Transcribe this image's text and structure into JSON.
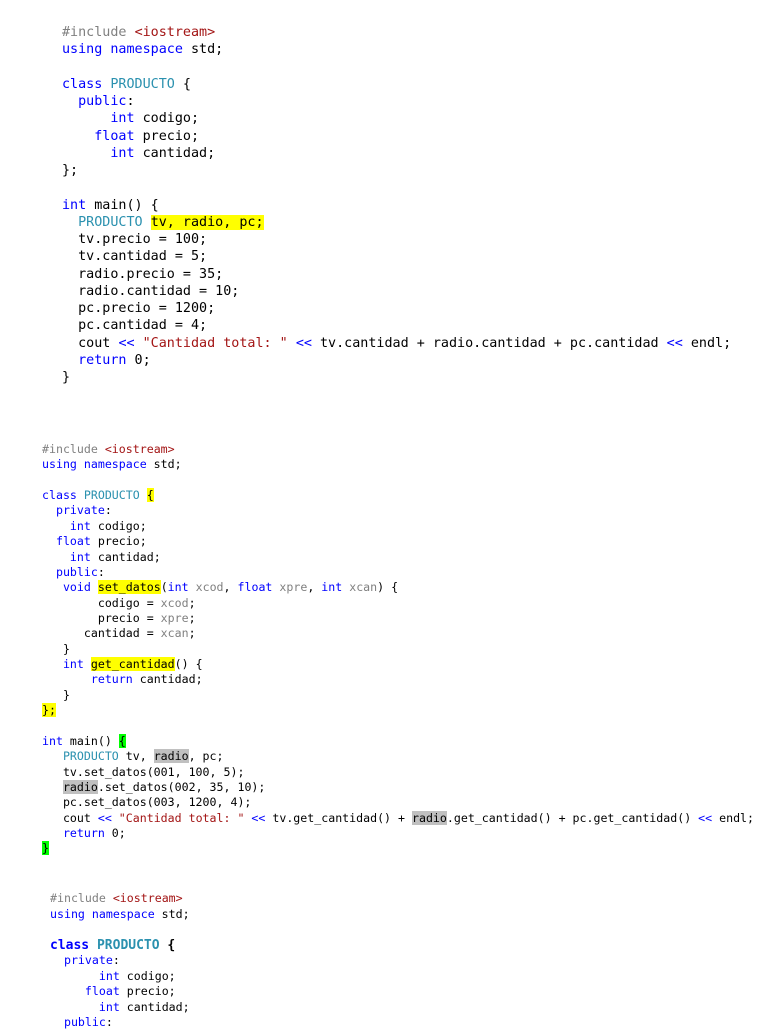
{
  "blocks": [
    {
      "lines": [
        [
          [
            "#include ",
            "pp"
          ],
          [
            "<iostream>",
            "str"
          ]
        ],
        [
          [
            "using namespace",
            "kw"
          ],
          [
            " std;",
            "plain"
          ]
        ],
        [],
        [
          [
            "class",
            "kw"
          ],
          [
            " ",
            "plain"
          ],
          [
            "PRODUCTO",
            "type"
          ],
          [
            " {",
            "plain"
          ]
        ],
        [
          [
            "  public",
            "kw"
          ],
          [
            ":",
            "plain"
          ]
        ],
        [
          [
            "      int",
            "kw"
          ],
          [
            " codigo;",
            "plain"
          ]
        ],
        [
          [
            "    float",
            "kw"
          ],
          [
            " precio;",
            "plain"
          ]
        ],
        [
          [
            "      int",
            "kw"
          ],
          [
            " cantidad;",
            "plain"
          ]
        ],
        [
          [
            "};",
            "plain"
          ]
        ],
        [],
        [
          [
            "int",
            "kw"
          ],
          [
            " main() {",
            "plain"
          ]
        ],
        [
          [
            "  PRODUCTO",
            "type"
          ],
          [
            " ",
            "plain"
          ],
          [
            "tv, radio, pc;",
            "plain",
            "yellow"
          ]
        ],
        [
          [
            "  tv.precio = 100;",
            "plain"
          ]
        ],
        [
          [
            "  tv.cantidad = 5;",
            "plain"
          ]
        ],
        [
          [
            "  radio.precio = 35;",
            "plain"
          ]
        ],
        [
          [
            "  radio.cantidad = 10;",
            "plain"
          ]
        ],
        [
          [
            "  pc.precio = 1200;",
            "plain"
          ]
        ],
        [
          [
            "  pc.cantidad = 4;",
            "plain"
          ]
        ],
        [
          [
            "  cout ",
            "plain"
          ],
          [
            "<<",
            "kw"
          ],
          [
            " ",
            "plain"
          ],
          [
            "\"Cantidad total: \"",
            "str"
          ],
          [
            " ",
            "plain"
          ],
          [
            "<<",
            "kw"
          ],
          [
            " tv.cantidad + radio.cantidad + pc.cantidad ",
            "plain"
          ],
          [
            "<<",
            "kw"
          ],
          [
            " endl;",
            "plain"
          ]
        ],
        [
          [
            "  return",
            "kw"
          ],
          [
            " 0;",
            "plain"
          ]
        ],
        [
          [
            "}",
            "plain"
          ]
        ]
      ]
    },
    {
      "lines": [
        [
          [
            "#include ",
            "pp"
          ],
          [
            "<iostream>",
            "str"
          ]
        ],
        [
          [
            "using namespace",
            "kw"
          ],
          [
            " std;",
            "plain"
          ]
        ],
        [],
        [
          [
            "class",
            "kw"
          ],
          [
            " ",
            "plain"
          ],
          [
            "PRODUCTO",
            "type"
          ],
          [
            " ",
            "plain"
          ],
          [
            "{",
            "plain",
            "yellow"
          ]
        ],
        [
          [
            "  private",
            "kw"
          ],
          [
            ":",
            "plain"
          ]
        ],
        [
          [
            "    int",
            "kw"
          ],
          [
            " codigo;",
            "plain"
          ]
        ],
        [
          [
            "  float",
            "kw"
          ],
          [
            " precio;",
            "plain"
          ]
        ],
        [
          [
            "    int",
            "kw"
          ],
          [
            " cantidad;",
            "plain"
          ]
        ],
        [
          [
            "  public",
            "kw"
          ],
          [
            ":",
            "plain"
          ]
        ],
        [
          [
            "   void",
            "kw"
          ],
          [
            " ",
            "plain"
          ],
          [
            "set_datos",
            "plain",
            "yellow"
          ],
          [
            "(",
            "plain"
          ],
          [
            "int",
            "kw"
          ],
          [
            " ",
            "plain"
          ],
          [
            "xcod",
            "param"
          ],
          [
            ", ",
            "plain"
          ],
          [
            "float",
            "kw"
          ],
          [
            " ",
            "plain"
          ],
          [
            "xpre",
            "param"
          ],
          [
            ", ",
            "plain"
          ],
          [
            "int",
            "kw"
          ],
          [
            " ",
            "plain"
          ],
          [
            "xcan",
            "param"
          ],
          [
            ") {",
            "plain"
          ]
        ],
        [
          [
            "        codigo = ",
            "plain"
          ],
          [
            "xcod",
            "param"
          ],
          [
            ";",
            "plain"
          ]
        ],
        [
          [
            "        precio = ",
            "plain"
          ],
          [
            "xpre",
            "param"
          ],
          [
            ";",
            "plain"
          ]
        ],
        [
          [
            "      cantidad = ",
            "plain"
          ],
          [
            "xcan",
            "param"
          ],
          [
            ";",
            "plain"
          ]
        ],
        [
          [
            "   }",
            "plain"
          ]
        ],
        [
          [
            "   int",
            "kw"
          ],
          [
            " ",
            "plain"
          ],
          [
            "get_cantidad",
            "plain",
            "yellow"
          ],
          [
            "() {",
            "plain"
          ]
        ],
        [
          [
            "       return",
            "kw"
          ],
          [
            " cantidad;",
            "plain"
          ]
        ],
        [
          [
            "   }",
            "plain"
          ]
        ],
        [
          [
            "};",
            "plain",
            "yellow"
          ]
        ],
        [],
        [
          [
            "int",
            "kw"
          ],
          [
            " main() ",
            "plain"
          ],
          [
            "{",
            "plain",
            "green"
          ]
        ],
        [
          [
            "   PRODUCTO",
            "type"
          ],
          [
            " tv, ",
            "plain"
          ],
          [
            "radio",
            "plain",
            "gray"
          ],
          [
            ", pc;",
            "plain"
          ]
        ],
        [
          [
            "   tv.set_datos(001, 100, 5);",
            "plain"
          ]
        ],
        [
          [
            "   ",
            "plain"
          ],
          [
            "radio",
            "plain",
            "gray"
          ],
          [
            ".set_datos(002, 35, 10);",
            "plain"
          ]
        ],
        [
          [
            "   pc.set_datos(003, 1200, 4);",
            "plain"
          ]
        ],
        [
          [
            "   cout ",
            "plain"
          ],
          [
            "<<",
            "kw"
          ],
          [
            " ",
            "plain"
          ],
          [
            "\"Cantidad total: \"",
            "str"
          ],
          [
            " ",
            "plain"
          ],
          [
            "<<",
            "kw"
          ],
          [
            " tv.get_cantidad() + ",
            "plain"
          ],
          [
            "radio",
            "plain",
            "gray"
          ],
          [
            ".get_cantidad() + pc.get_cantidad() ",
            "plain"
          ],
          [
            "<<",
            "kw"
          ],
          [
            " endl;",
            "plain"
          ]
        ],
        [
          [
            "   return",
            "kw"
          ],
          [
            " 0;",
            "plain"
          ]
        ],
        [
          [
            "}",
            "plain",
            "green"
          ]
        ]
      ]
    },
    {
      "lines": [
        [
          [
            "#include ",
            "pp"
          ],
          [
            "<iostream>",
            "str"
          ]
        ],
        [
          [
            "using namespace",
            "kw"
          ],
          [
            " std;",
            "plain"
          ]
        ],
        [],
        [
          [
            "class",
            "kw"
          ],
          [
            " ",
            "plain"
          ],
          [
            "PRODUCTO",
            "type"
          ],
          [
            " {",
            "plain"
          ]
        ],
        [
          [
            "  private",
            "kw"
          ],
          [
            ":",
            "plain"
          ]
        ],
        [
          [
            "       int",
            "kw"
          ],
          [
            " codigo;",
            "plain"
          ]
        ],
        [
          [
            "     float",
            "kw"
          ],
          [
            " precio;",
            "plain"
          ]
        ],
        [
          [
            "       int",
            "kw"
          ],
          [
            " cantidad;",
            "plain"
          ]
        ],
        [
          [
            "  public",
            "kw"
          ],
          [
            ":",
            "plain"
          ]
        ]
      ]
    }
  ]
}
